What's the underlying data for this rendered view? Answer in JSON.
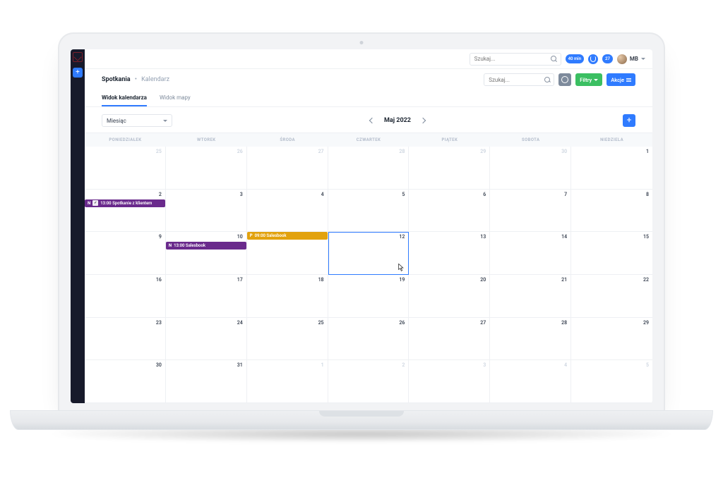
{
  "topbar": {
    "search_placeholder": "Szukaj...",
    "chip1": "40 min",
    "chip2": "27",
    "user_initials": "MB"
  },
  "page": {
    "title": "Spotkania",
    "sep": "•",
    "sub": "Kalendarz",
    "search_placeholder": "Szukaj...",
    "filters_label": "Filtry",
    "actions_label": "Akcje"
  },
  "tabs": {
    "calendar": "Widok kalendarza",
    "map": "Widok mapy"
  },
  "toolbar": {
    "view_select": "Miesiąc",
    "month_label": "Maj 2022"
  },
  "weekdays": [
    "PONIEDZIAŁEK",
    "WTOREK",
    "ŚRODA",
    "CZWARTEK",
    "PIĄTEK",
    "SOBOTA",
    "NIEDZIELA"
  ],
  "weeks": [
    [
      {
        "n": "25",
        "muted": true
      },
      {
        "n": "26",
        "muted": true
      },
      {
        "n": "27",
        "muted": true
      },
      {
        "n": "28",
        "muted": true
      },
      {
        "n": "29",
        "muted": true
      },
      {
        "n": "30",
        "muted": true
      },
      {
        "n": "1"
      }
    ],
    [
      {
        "n": "2",
        "event": {
          "color": "purple",
          "pre": "N",
          "badge": "✓",
          "time": "13:00",
          "text": "Spotkanie z klientem"
        }
      },
      {
        "n": "3"
      },
      {
        "n": "4"
      },
      {
        "n": "5"
      },
      {
        "n": "6"
      },
      {
        "n": "7"
      },
      {
        "n": "8"
      }
    ],
    [
      {
        "n": "9"
      },
      {
        "n": "10",
        "event": {
          "color": "purple",
          "pre": "N",
          "time": "13:00",
          "text": "Salesbook"
        }
      },
      {
        "n": "11",
        "event": {
          "color": "amber",
          "pre": "P",
          "time": "09:00",
          "text": "Salesbook",
          "top": true
        }
      },
      {
        "n": "12",
        "selected": true,
        "cursor": true
      },
      {
        "n": "13"
      },
      {
        "n": "14"
      },
      {
        "n": "15"
      }
    ],
    [
      {
        "n": "16"
      },
      {
        "n": "17"
      },
      {
        "n": "18"
      },
      {
        "n": "19"
      },
      {
        "n": "20"
      },
      {
        "n": "21"
      },
      {
        "n": "22"
      }
    ],
    [
      {
        "n": "23"
      },
      {
        "n": "24"
      },
      {
        "n": "25"
      },
      {
        "n": "26"
      },
      {
        "n": "27"
      },
      {
        "n": "28"
      },
      {
        "n": "29"
      }
    ],
    [
      {
        "n": "30"
      },
      {
        "n": "31"
      },
      {
        "n": "1",
        "muted": true
      },
      {
        "n": "2",
        "muted": true
      },
      {
        "n": "3",
        "muted": true
      },
      {
        "n": "4",
        "muted": true
      },
      {
        "n": "5",
        "muted": true
      }
    ]
  ]
}
